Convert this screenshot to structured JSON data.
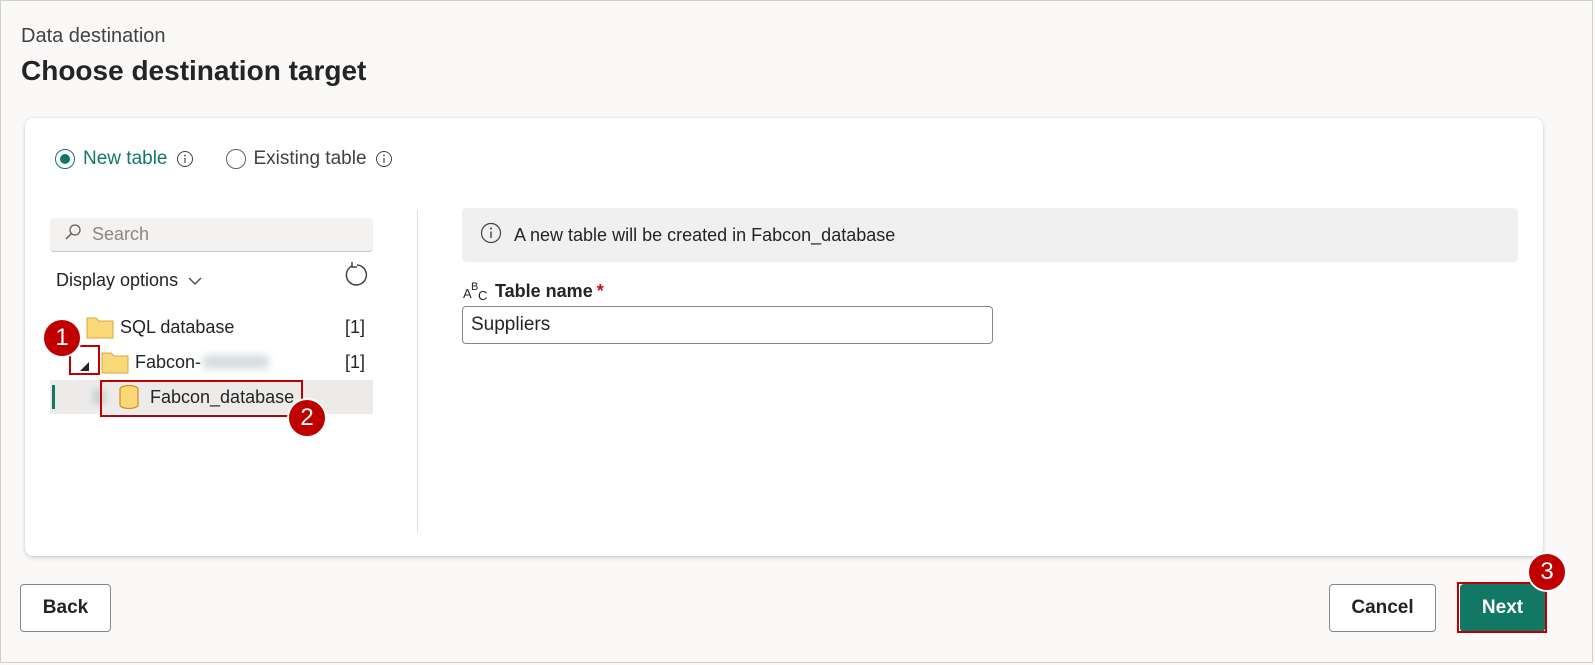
{
  "header": {
    "breadcrumb": "Data destination",
    "title": "Choose destination target"
  },
  "radio": {
    "new_table": "New table",
    "existing_table": "Existing table",
    "selected": "new_table"
  },
  "search": {
    "placeholder": "Search"
  },
  "display_options": "Display options",
  "tree": [
    {
      "label": "SQL database",
      "count": "[1]"
    },
    {
      "label": "Fabcon-",
      "count": "[1]"
    },
    {
      "label": "Fabcon_database"
    }
  ],
  "info_banner": "A new table will be created in Fabcon_database",
  "table_name": {
    "label": "Table name",
    "required_mark": "*",
    "value": "Suppliers",
    "type_icon_text": "ABC"
  },
  "buttons": {
    "back": "Back",
    "cancel": "Cancel",
    "next": "Next"
  },
  "callouts": [
    "1",
    "2",
    "3"
  ],
  "colors": {
    "accent": "#117865",
    "callout": "#c00000",
    "folder": "#f5c85a"
  }
}
